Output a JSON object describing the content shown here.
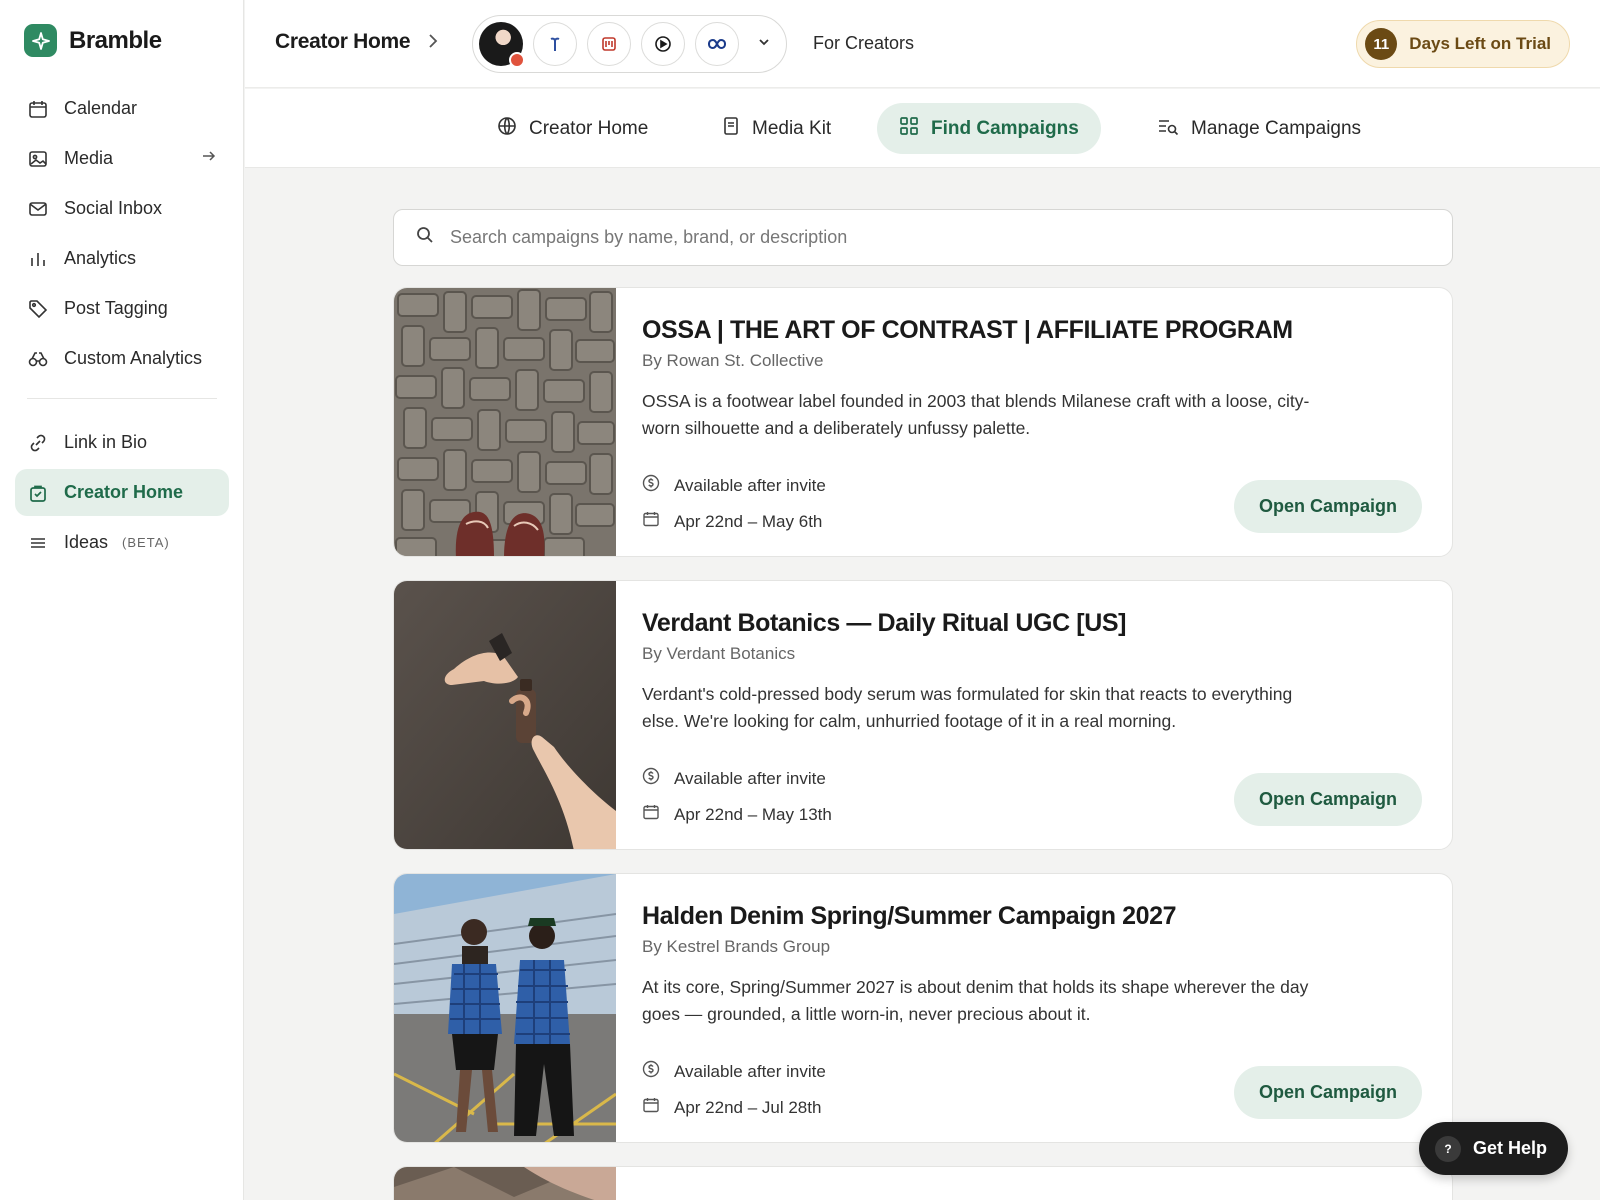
{
  "brand": {
    "name": "Bramble",
    "accent": "#2f8a62"
  },
  "sidebar": {
    "items": [
      {
        "label": "Calendar",
        "icon": "calendar-icon"
      },
      {
        "label": "Media",
        "icon": "image-icon",
        "trailing_icon": "arrow-right-icon"
      },
      {
        "label": "Social Inbox",
        "icon": "mail-icon"
      },
      {
        "label": "Analytics",
        "icon": "bar-chart-icon"
      },
      {
        "label": "Post Tagging",
        "icon": "tag-icon"
      },
      {
        "label": "Custom Analytics",
        "icon": "binoculars-icon"
      }
    ],
    "secondary": [
      {
        "label": "Link in Bio",
        "icon": "link-icon"
      },
      {
        "label": "Creator Home",
        "icon": "shopping-bag-icon",
        "active": true
      },
      {
        "label": "Ideas",
        "icon": "lines-icon",
        "badge": "(BETA)"
      }
    ]
  },
  "header": {
    "breadcrumb": "Creator Home",
    "channels": [
      "avatar",
      "threads-icon",
      "bluesky-icon",
      "youtube-icon",
      "meta-icon"
    ],
    "for_creators": "For Creators",
    "trial": {
      "count": "11",
      "label": "Days Left on Trial"
    }
  },
  "tabs": [
    {
      "label": "Creator Home",
      "icon": "globe-icon"
    },
    {
      "label": "Media Kit",
      "icon": "document-icon"
    },
    {
      "label": "Find Campaigns",
      "icon": "grid-icon",
      "active": true
    },
    {
      "label": "Manage Campaigns",
      "icon": "list-search-icon"
    }
  ],
  "search": {
    "placeholder": "Search campaigns by name, brand, or description",
    "value": ""
  },
  "campaigns": [
    {
      "title": "OSSA | THE ART OF CONTRAST | AFFILIATE PROGRAM",
      "brand": "By Rowan St. Collective",
      "description": "OSSA is a footwear label founded in 2003 that blends Milanese craft with a loose, city-worn silhouette and a deliberately unfussy palette.",
      "payout": "Available after invite",
      "dates": "Apr 22nd – May 6th",
      "button": "Open Campaign"
    },
    {
      "title": "Verdant Botanics — Daily Ritual UGC [US]",
      "brand": "By Verdant Botanics",
      "description": "Verdant's cold-pressed body serum was formulated for skin that reacts to everything else. We're looking for calm, unhurried footage of it in a real morning.",
      "payout": "Available after invite",
      "dates": "Apr 22nd – May 13th",
      "button": "Open Campaign"
    },
    {
      "title": "Halden Denim Spring/Summer Campaign 2027",
      "brand": "By Kestrel Brands Group",
      "description": "At its core, Spring/Summer 2027 is about denim that holds its shape wherever the day goes — grounded, a little worn-in, never precious about it.",
      "payout": "Available after invite",
      "dates": "Apr 22nd – Jul 28th",
      "button": "Open Campaign"
    }
  ],
  "help": {
    "label": "Get Help",
    "icon": "question-icon"
  }
}
